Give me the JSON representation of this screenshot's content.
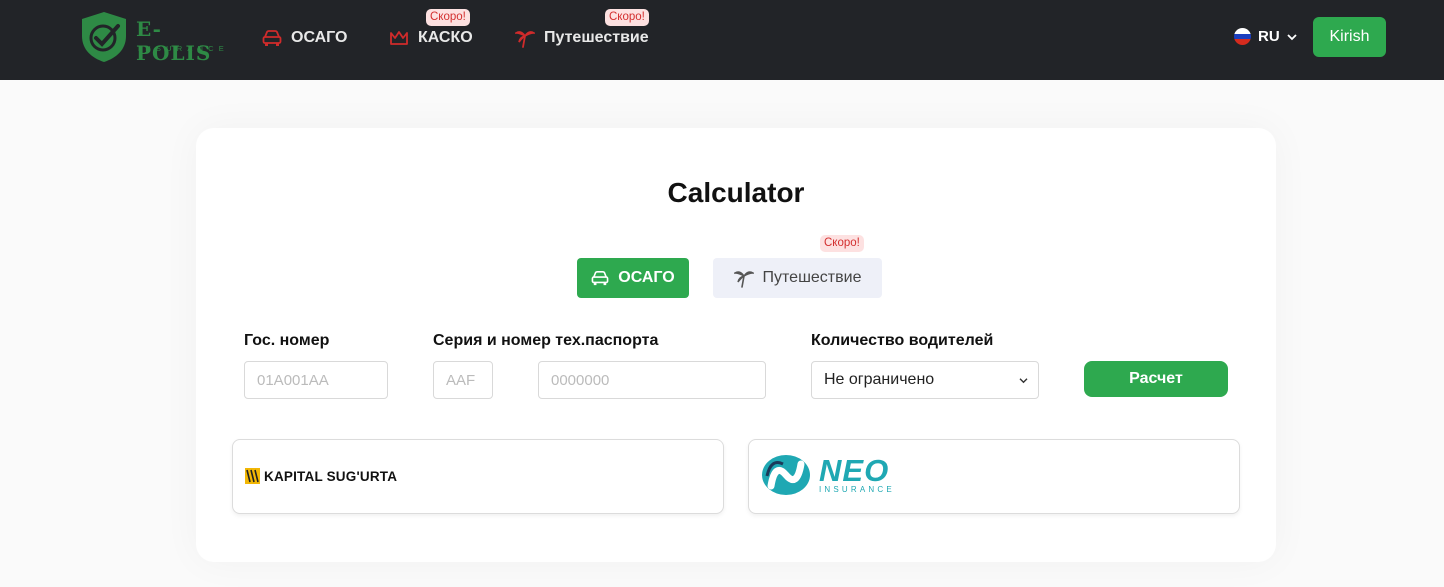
{
  "header": {
    "logo_title": "E-POLIS",
    "logo_subtitle": "INSURANCE",
    "nav": [
      {
        "label": "ОСАГО",
        "icon": "car-icon"
      },
      {
        "label": "КАСКО",
        "icon": "crown-icon",
        "badge": "Скоро!"
      },
      {
        "label": "Путешествие",
        "icon": "palm-tree-icon",
        "badge": "Скоро!"
      }
    ],
    "language": "RU",
    "login_label": "Kirish"
  },
  "calculator": {
    "title": "Calculator",
    "tabs": [
      {
        "label": "ОСАГО",
        "icon": "car-icon",
        "active": true
      },
      {
        "label": "Путешествие",
        "icon": "palm-tree-icon",
        "active": false,
        "badge": "Скоро!"
      }
    ],
    "fields": {
      "plate_label": "Гос. номер",
      "plate_placeholder": "01A001AA",
      "passport_label": "Серия и номер тех.паспорта",
      "series_placeholder": "AAF",
      "number_placeholder": "0000000",
      "drivers_label": "Количество водителей",
      "drivers_value": "Не ограничено"
    },
    "submit_label": "Расчет",
    "companies": [
      {
        "name": "KAPITAL SUG'URTA"
      },
      {
        "name": "NEO",
        "subtitle": "INSURANCE"
      }
    ]
  },
  "colors": {
    "header_bg": "#222428",
    "accent_green": "#2ea94f",
    "badge_red": "#d32f2f",
    "icon_red": "#d02b2b"
  }
}
